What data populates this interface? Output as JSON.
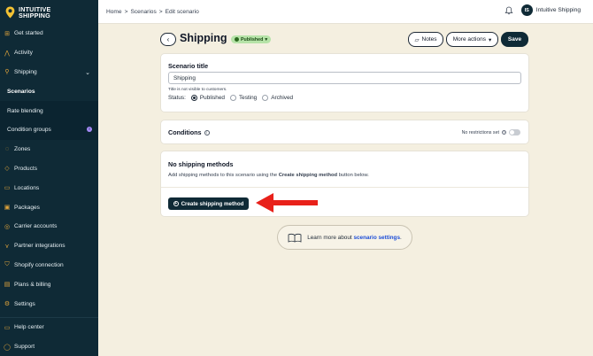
{
  "app": {
    "name_line1": "INTUITIVE",
    "name_line2": "SHIPPING"
  },
  "sidebar": {
    "items": [
      {
        "label": "Get started",
        "icon": "bolt-icon"
      },
      {
        "label": "Activity",
        "icon": "activity-icon"
      },
      {
        "label": "Shipping",
        "icon": "shipping-icon"
      },
      {
        "label": "Scenarios"
      },
      {
        "label": "Rate blending"
      },
      {
        "label": "Condition groups",
        "badge": "!"
      },
      {
        "label": "Zones",
        "icon": "zones-icon"
      },
      {
        "label": "Products",
        "icon": "products-icon"
      },
      {
        "label": "Locations",
        "icon": "locations-icon"
      },
      {
        "label": "Packages",
        "icon": "packages-icon"
      },
      {
        "label": "Carrier accounts",
        "icon": "carrier-icon"
      },
      {
        "label": "Partner integrations",
        "icon": "partner-icon"
      },
      {
        "label": "Shopify connection",
        "icon": "shopify-icon"
      },
      {
        "label": "Plans & billing",
        "icon": "billing-icon"
      },
      {
        "label": "Settings",
        "icon": "gear-icon"
      }
    ],
    "bottom": [
      {
        "label": "Help center",
        "icon": "help-icon"
      },
      {
        "label": "Support",
        "icon": "support-icon"
      }
    ]
  },
  "topbar": {
    "breadcrumb": [
      "Home",
      ">",
      "Scenarios",
      ">",
      "Edit scenario"
    ],
    "user_initials": "IS",
    "user_name": "Intuitive Shipping"
  },
  "header": {
    "title": "Shipping",
    "status": "Published",
    "notes_label": "Notes",
    "more_label": "More actions",
    "save_label": "Save"
  },
  "scenario_card": {
    "title": "Scenario title",
    "input_value": "Shipping",
    "hint": "Title is not visible to customers.",
    "status_label": "Status:",
    "options": [
      "Published",
      "Testing",
      "Archived"
    ],
    "selected": "Published"
  },
  "conditions_card": {
    "title": "Conditions",
    "restriction_text": "No restrictions set"
  },
  "methods_card": {
    "title": "No shipping methods",
    "desc_prefix": "Add shipping methods to this scenario using the ",
    "desc_bold": "Create shipping method",
    "desc_suffix": " button below.",
    "create_label": "Create shipping method"
  },
  "learn": {
    "prefix": "Learn more about ",
    "link": "scenario settings",
    "suffix": "."
  },
  "colors": {
    "sidebar_bg": "#0f2a36",
    "page_bg": "#f4efe0",
    "accent": "#e1a43a",
    "arrow": "#e8211a",
    "published": "#b6e3a8"
  }
}
